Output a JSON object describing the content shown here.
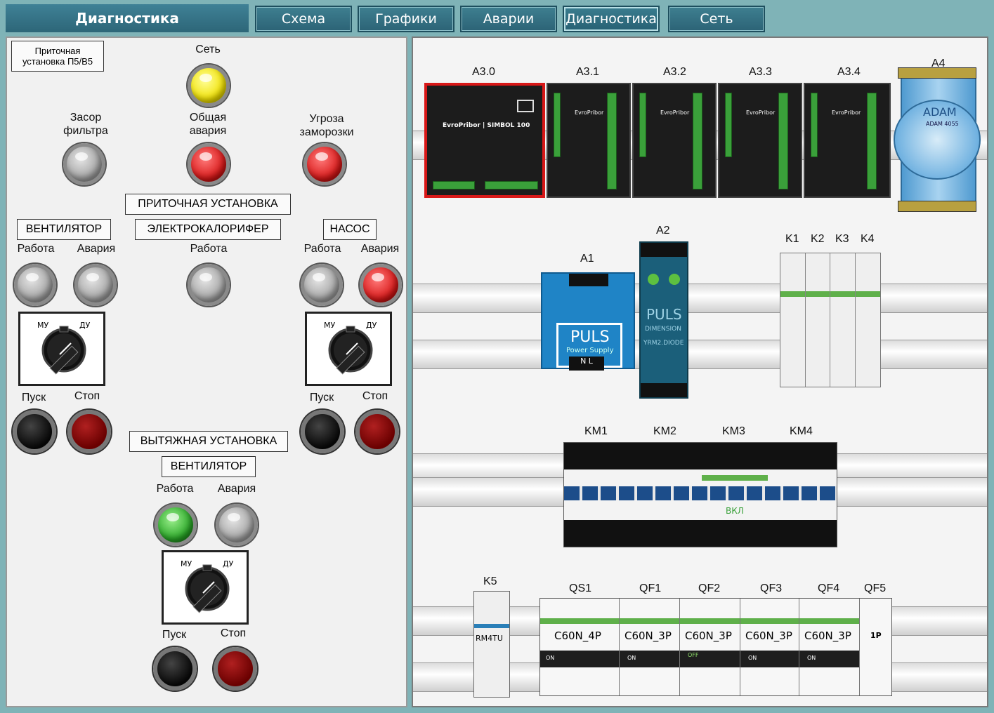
{
  "header": {
    "title": "Диагностика",
    "tabs": [
      {
        "label": "Схема"
      },
      {
        "label": "Графики"
      },
      {
        "label": "Аварии"
      },
      {
        "label": "Диагностика"
      },
      {
        "label": "Сеть"
      }
    ]
  },
  "left": {
    "unit_box": "Приточная установка П5/В5",
    "unit_box_line1": "Приточная",
    "unit_box_line2": "установка П5/В5",
    "network": "Сеть",
    "filter": "Засор фильтра",
    "filter_l1": "Засор",
    "filter_l2": "фильтра",
    "general_alarm_l1": "Общая",
    "general_alarm_l2": "авария",
    "frost_l1": "Угроза",
    "frost_l2": "заморозки",
    "supply_unit": "ПРИТОЧНАЯ УСТАНОВКА",
    "fan": "ВЕНТИЛЯТОР",
    "heater": "ЭЛЕКТРОКАЛОРИФЕР",
    "pump": "НАСОС",
    "work": "Работа",
    "alarm": "Авария",
    "start": "Пуск",
    "stop": "Стоп",
    "mu": "МУ",
    "du": "ДУ",
    "exhaust_unit": "ВЫТЯЖНАЯ УСТАНОВКА",
    "exhaust_fan": "ВЕНТИЛЯТОР"
  },
  "right": {
    "modules": [
      "A3.0",
      "A3.1",
      "A3.2",
      "A3.3",
      "A3.4",
      "A4"
    ],
    "brand_main": "EvroPribor | SIMBOL 100",
    "brand_small": "EvroPribor",
    "adam": "ADAM",
    "adam_model": "ADAM 4055",
    "a1": "A1",
    "a2": "A2",
    "puls": "PULS",
    "power_supply": "Power Supply",
    "dimension": "DIMENSION",
    "yrm": "YRM2.DIODE",
    "nl": "N L",
    "relays": [
      "K1",
      "K2",
      "K3",
      "K4"
    ],
    "contactors": [
      "KM1",
      "KM2",
      "KM3",
      "KM4"
    ],
    "vkl": "ВКЛ",
    "k5": "K5",
    "rm4tu": "RM4TU",
    "breakers": [
      {
        "name": "QS1",
        "label": "C60N_4P"
      },
      {
        "name": "QF1",
        "label": "C60N_3P"
      },
      {
        "name": "QF2",
        "label": "C60N_3P"
      },
      {
        "name": "QF3",
        "label": "C60N_3P"
      },
      {
        "name": "QF4",
        "label": "C60N_3P"
      },
      {
        "name": "QF5",
        "label": "1P"
      }
    ],
    "on": "ON",
    "off": "OFF"
  }
}
